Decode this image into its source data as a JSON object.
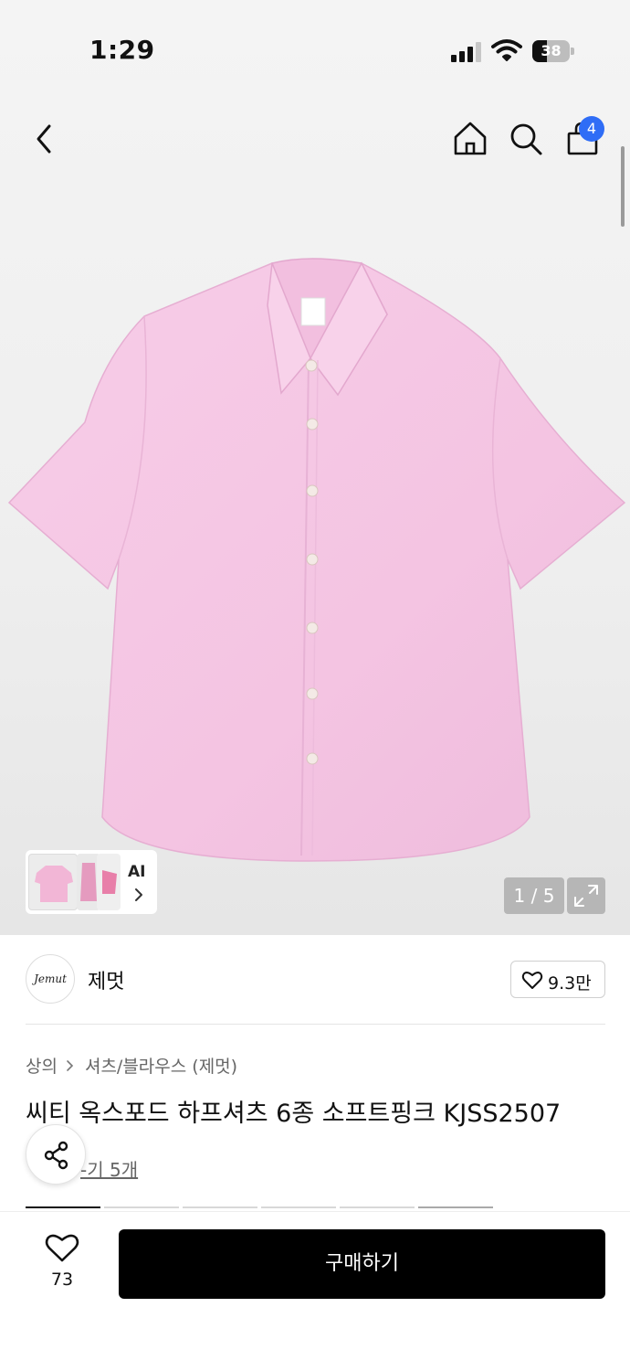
{
  "status_bar": {
    "time": "1:29",
    "battery_level": "38"
  },
  "nav": {
    "back_icon": "chevron-left-icon",
    "home_icon": "home-icon",
    "search_icon": "search-icon",
    "cart_icon": "shopping-bag-icon",
    "cart_badge": "4"
  },
  "gallery": {
    "image_subject": "pink short-sleeve shirt",
    "ai_label": "AI",
    "page_indicator": "1 / 5",
    "expand_icon": "expand-icon"
  },
  "brand": {
    "logo_text": "Jemut",
    "name": "제멋",
    "like_count": "9.3만"
  },
  "breadcrumb": {
    "category": "상의",
    "subcategory": "셔츠/블라우스 (제멋)"
  },
  "product": {
    "title": "씨티 옥스포드 하프셔츠 6종 소프트핑크 KJSS2507",
    "reviews_link": "-기 5개"
  },
  "bottom_bar": {
    "wish_count": "73",
    "buy_label": "구매하기"
  },
  "colors": {
    "accent_badge": "#2f6df6",
    "buy_button": "#000000",
    "shirt": "#f5c6e4"
  }
}
